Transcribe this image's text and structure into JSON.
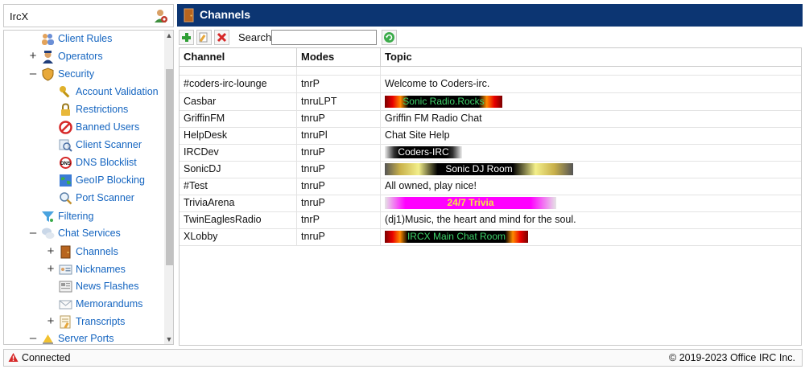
{
  "app": {
    "title": "IrcX"
  },
  "tree": {
    "items": [
      {
        "label": "Client Rules",
        "icon": "users-icon"
      },
      {
        "label": "Operators",
        "icon": "operator-icon",
        "toggle": "+"
      },
      {
        "label": "Security",
        "icon": "shield-icon",
        "toggle": "–"
      },
      {
        "label": "Account Validation",
        "icon": "key-icon"
      },
      {
        "label": "Restrictions",
        "icon": "lock-icon"
      },
      {
        "label": "Banned Users",
        "icon": "ban-icon"
      },
      {
        "label": "Client Scanner",
        "icon": "scanner-icon"
      },
      {
        "label": "DNS Blocklist",
        "icon": "dns-block-icon"
      },
      {
        "label": "GeoIP Blocking",
        "icon": "globe-icon"
      },
      {
        "label": "Port Scanner",
        "icon": "magnifier-icon"
      },
      {
        "label": "Filtering",
        "icon": "filter-icon"
      },
      {
        "label": "Chat Services",
        "icon": "chat-icon",
        "toggle": "–"
      },
      {
        "label": "Channels",
        "icon": "channel-door-icon",
        "toggle": "+"
      },
      {
        "label": "Nicknames",
        "icon": "id-card-icon",
        "toggle": "+"
      },
      {
        "label": "News Flashes",
        "icon": "newspaper-icon"
      },
      {
        "label": "Memorandums",
        "icon": "envelope-icon"
      },
      {
        "label": "Transcripts",
        "icon": "transcript-icon",
        "toggle": "+"
      },
      {
        "label": "Server Ports",
        "icon": "server-ports-icon",
        "toggle": "–"
      }
    ]
  },
  "panel": {
    "title": "Channels"
  },
  "toolbar": {
    "search_label": "Search:",
    "search_value": ""
  },
  "grid": {
    "headers": {
      "channel": "Channel",
      "modes": "Modes",
      "topic": "Topic"
    },
    "rows": [
      {
        "channel": "#coders-irc-lounge",
        "modes": "tnrP",
        "topic": "Welcome to Coders-irc."
      },
      {
        "channel": "Casbar",
        "modes": "tnruLPT",
        "topic": "Sonic Radio.Rocks"
      },
      {
        "channel": "GriffinFM",
        "modes": "tnruP",
        "topic": "Griffin FM Radio Chat"
      },
      {
        "channel": "HelpDesk",
        "modes": "tnruPl",
        "topic": "Chat Site Help"
      },
      {
        "channel": "IRCDev",
        "modes": "tnruP",
        "topic": "Coders-IRC"
      },
      {
        "channel": "SonicDJ",
        "modes": "tnruP",
        "topic": "Sonic DJ Room"
      },
      {
        "channel": "#Test",
        "modes": "tnruP",
        "topic": "All owned, play nice!"
      },
      {
        "channel": "TriviaArena",
        "modes": "tnruP",
        "topic": "24/7 Trivia"
      },
      {
        "channel": "TwinEaglesRadio",
        "modes": "tnrP",
        "topic": "(dj1)Music, the heart and mind for the soul."
      },
      {
        "channel": "XLobby",
        "modes": "tnruP",
        "topic": "IRCX Main Chat Room"
      }
    ]
  },
  "status": {
    "text": "Connected",
    "copyright": "© 2019-2023 Office IRC Inc."
  }
}
